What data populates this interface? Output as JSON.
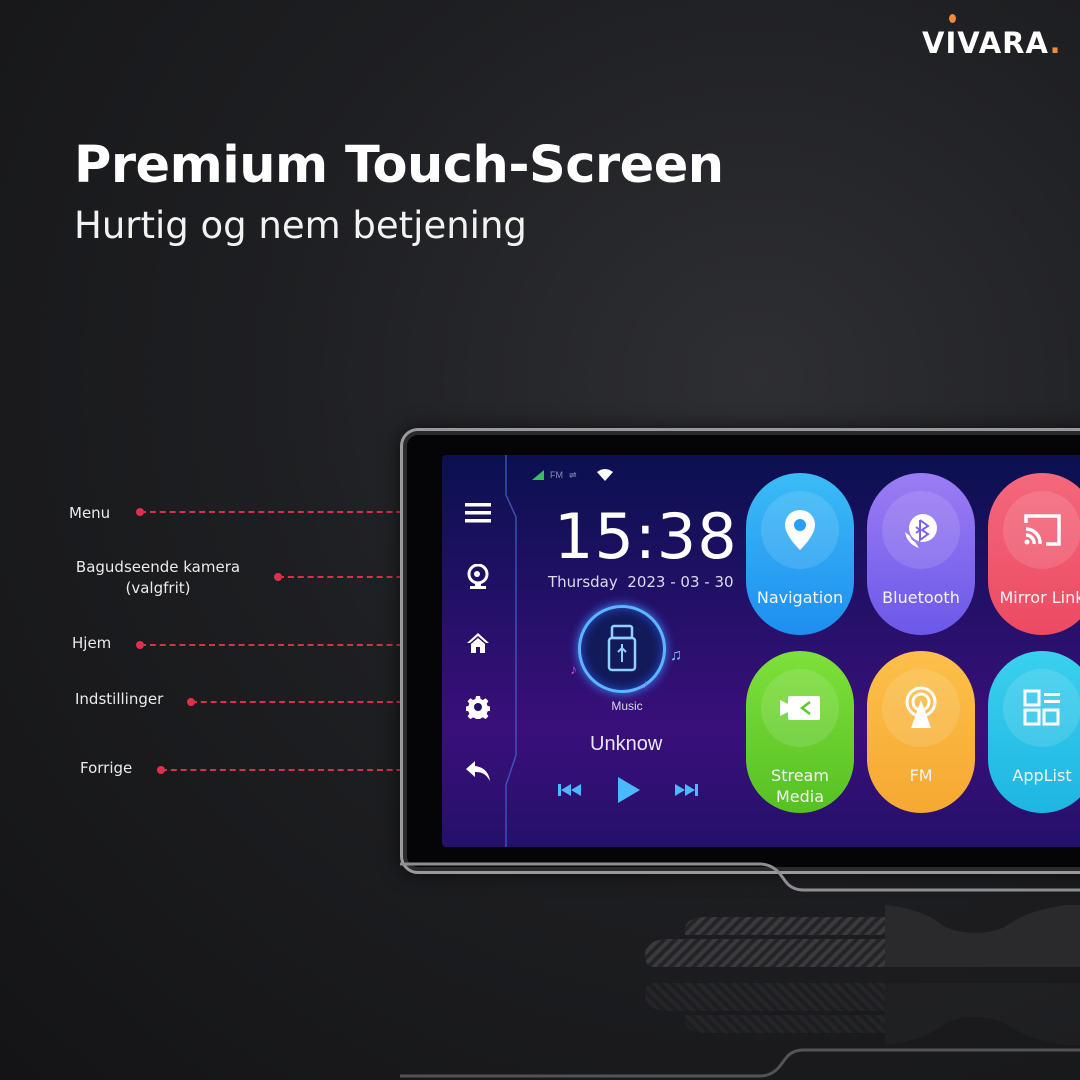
{
  "brand": {
    "name": "VIVARA",
    "accent_dot": ".",
    "accent_color": "#f08a3c"
  },
  "header": {
    "title": "Premium Touch-Screen",
    "subtitle": "Hurtig og nem betjening"
  },
  "callouts": [
    {
      "label": "Menu",
      "target_icon": "menu-icon"
    },
    {
      "label_line1": "Bagudseende kamera",
      "label_line2": "(valgfrit)",
      "target_icon": "webcam-icon"
    },
    {
      "label": "Hjem",
      "target_icon": "home-icon"
    },
    {
      "label": "Indstillinger",
      "target_icon": "gear-icon"
    },
    {
      "label": "Forrige",
      "target_icon": "back-icon"
    }
  ],
  "callout_color": "#e0304c",
  "screen": {
    "status_bar": {
      "fm": "FM",
      "icons": [
        "signal-icon",
        "usb-icon",
        "wifi-icon"
      ]
    },
    "clock": {
      "time": "15:38",
      "weekday": "Thursday",
      "date": "2023 - 03 - 30"
    },
    "music": {
      "label": "Music",
      "track": "Unknow",
      "source_icon": "usb-drive-icon"
    },
    "controls": [
      "previous",
      "play",
      "next"
    ],
    "apps": [
      {
        "label": "Navigation",
        "icon": "map-pin-icon",
        "color": "#2fa6f0"
      },
      {
        "label": "Bluetooth",
        "icon": "bluetooth-phone-icon",
        "color": "#8a6cf0"
      },
      {
        "label": "Mirror Link",
        "icon": "cast-icon",
        "color": "#f05870"
      },
      {
        "label_line1": "Stream",
        "label_line2": "Media",
        "icon": "video-camera-icon",
        "color": "#6fd030"
      },
      {
        "label": "FM",
        "icon": "radio-tower-icon",
        "color": "#f8b23a"
      },
      {
        "label": "AppList",
        "icon": "app-grid-icon",
        "color": "#2ec4e8"
      }
    ]
  }
}
